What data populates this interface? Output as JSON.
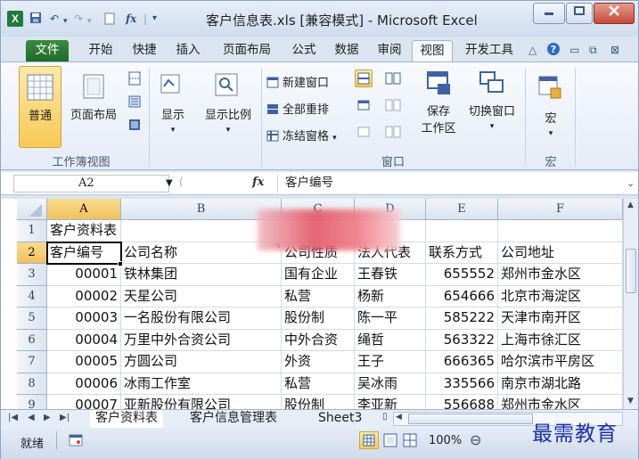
{
  "app": {
    "title": "客户信息表.xls  [兼容模式] - Microsoft Excel",
    "logo_letter": "X",
    "fx_quick": "fx"
  },
  "ribbon_tabs": [
    "文件",
    "开始",
    "快捷",
    "插入",
    "页面布局",
    "公式",
    "数据",
    "审阅",
    "视图",
    "开发工具"
  ],
  "ribbon": {
    "workbook_views": {
      "group_label": "工作簿视图",
      "normal": "普通",
      "page_layout": "页面布局"
    },
    "show": {
      "label": "显示"
    },
    "zoom": {
      "label": "显示比例"
    },
    "window": {
      "group_label": "窗口",
      "new_window": "新建窗口",
      "arrange_all": "全部重排",
      "freeze_panes": "冻结窗格",
      "save_workspace_line1": "保存",
      "save_workspace_line2": "工作区",
      "switch_windows": "切换窗口"
    },
    "macros": {
      "group_label": "宏",
      "label": "宏"
    }
  },
  "formula_bar": {
    "name_box": "A2",
    "fx_label": "fx",
    "content": "客户编号"
  },
  "grid": {
    "columns": [
      "A",
      "B",
      "C",
      "D",
      "E",
      "F"
    ],
    "rows": [
      "1",
      "2",
      "3",
      "4",
      "5",
      "6",
      "7",
      "8",
      "9"
    ],
    "title_cell": "客户资料表",
    "headers": [
      "客户编号",
      "公司名称",
      "公司性质",
      "法人代表",
      "联系方式",
      "公司地址"
    ],
    "data": [
      [
        "00001",
        "铁林集团",
        "国有企业",
        "王春铁",
        "655552",
        "郑州市金水区"
      ],
      [
        "00002",
        "天星公司",
        "私营",
        "杨新",
        "654666",
        "北京市海淀区"
      ],
      [
        "00003",
        "一名股份有限公司",
        "股份制",
        "陈一平",
        "585222",
        "天津市南开区"
      ],
      [
        "00004",
        "万里中外合资公司",
        "中外合资",
        "绳哲",
        "563322",
        "上海市徐汇区"
      ],
      [
        "00005",
        "方圆公司",
        "外资",
        "王子",
        "666365",
        "哈尔滨市平房区"
      ],
      [
        "00006",
        "冰雨工作室",
        "私营",
        "吴冰雨",
        "335566",
        "南京市湖北路"
      ],
      [
        "00007",
        "亚新股份有限公司",
        "股份制",
        "李亚新",
        "556688",
        "郑州市金水区"
      ]
    ]
  },
  "sheets": [
    "客户资料表",
    "客户信息管理表",
    "Sheet3"
  ],
  "status": {
    "ready": "就绪",
    "zoom": "100%"
  },
  "watermark": "最需教育"
}
